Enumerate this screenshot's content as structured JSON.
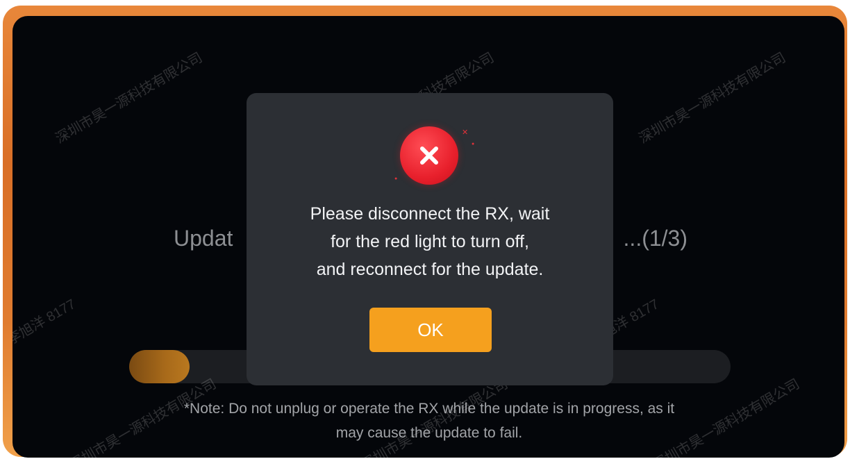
{
  "background": {
    "title_left": "Updat",
    "title_right": "...(1/3)",
    "progress": 0.1,
    "note_line1": "*Note: Do not unplug or operate the RX while the update is in progress, as it",
    "note_line2": "may cause the update to fail."
  },
  "watermarks": {
    "company": "深圳市昊一源科技有限公司",
    "user": "李旭洋 8177"
  },
  "dialog": {
    "icon": "error-x-icon",
    "message_line1": "Please disconnect the RX, wait",
    "message_line2": "for the red light to turn off,",
    "message_line3": "and reconnect for the update.",
    "ok_label": "OK"
  },
  "colors": {
    "accent": "#f5a01e",
    "error": "#e8202c",
    "dialog_bg": "#2c2f34",
    "screen_bg": "#04060a",
    "frame": "#e07c30"
  }
}
